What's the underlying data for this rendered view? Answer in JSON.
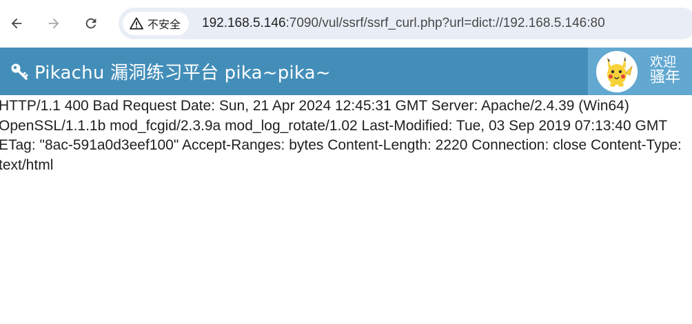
{
  "browser": {
    "security_label": "不安全",
    "url": {
      "host": "192.168.5.146",
      "path": ":7090/vul/ssrf/ssrf_curl.php?url=dict://192.168.5.146:80"
    },
    "icons": [
      "back-arrow-icon",
      "forward-arrow-icon",
      "reload-icon",
      "warning-triangle-icon"
    ]
  },
  "site": {
    "title": "Pikachu 漏洞练习平台 pika~pika~",
    "brand_icon": "key-icon",
    "header_color": "#438eb9",
    "user_panel_color": "#62a8d1",
    "welcome_text": "欢迎",
    "user_name": "骚年"
  },
  "content": {
    "response_text": "HTTP/1.1 400 Bad Request Date: Sun, 21 Apr 2024 12:45:31 GMT Server: Apache/2.4.39 (Win64) OpenSSL/1.1.1b mod_fcgid/2.3.9a mod_log_rotate/1.02 Last-Modified: Tue, 03 Sep 2019 07:13:40 GMT ETag: \"8ac-591a0d3eef100\" Accept-Ranges: bytes Content-Length: 2220 Connection: close Content-Type: text/html"
  }
}
